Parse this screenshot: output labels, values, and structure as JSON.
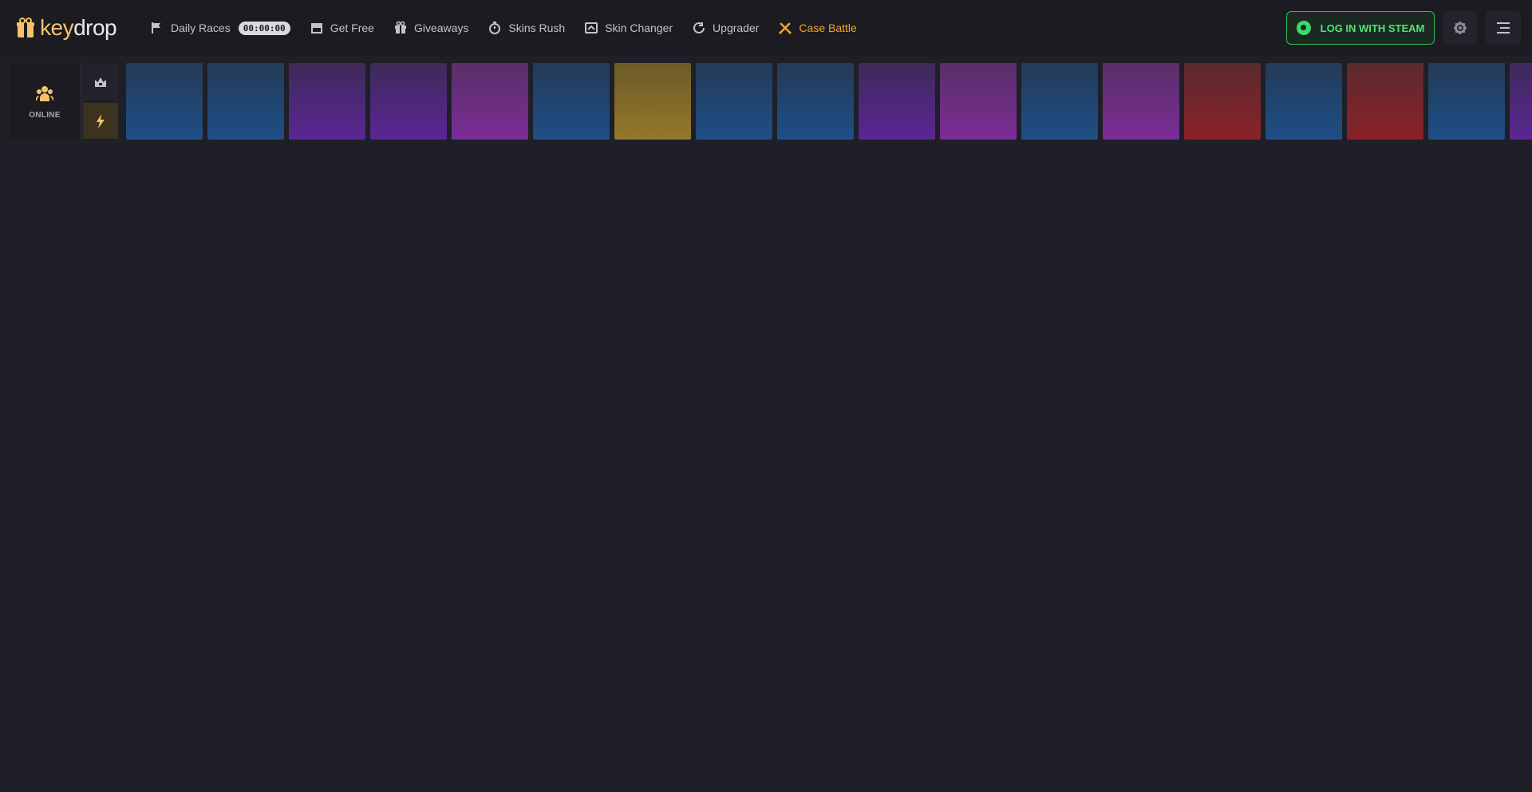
{
  "brand": {
    "logo_text_key": "key",
    "logo_text_drop": "drop"
  },
  "nav": {
    "items": [
      {
        "label": "Daily Races",
        "icon": "flag-icon"
      },
      {
        "label": "Get Free",
        "icon": "box-icon"
      },
      {
        "label": "Giveaways",
        "icon": "gift-icon"
      },
      {
        "label": "Skins Rush",
        "icon": "stopwatch-icon"
      },
      {
        "label": "Skin Changer",
        "icon": "swap-icon"
      },
      {
        "label": "Upgrader",
        "icon": "refresh-icon"
      },
      {
        "label": "Case Battle",
        "icon": "crossed-swords-icon"
      }
    ],
    "timer": "00:00:00"
  },
  "auth": {
    "login_label": "LOG IN WITH STEAM"
  },
  "sidebar": {
    "online_label": "ONLINE"
  },
  "colors": {
    "accent_orange": "#f5a623",
    "steam_green": "#4fe37a",
    "background": "#1f1f27"
  },
  "drops_strip": {
    "cards": [
      "blue",
      "blue",
      "purple",
      "purple",
      "pink",
      "blue",
      "gold",
      "blue",
      "blue",
      "purple",
      "pink",
      "blue",
      "pink",
      "red",
      "blue",
      "red",
      "blue",
      "purple"
    ]
  }
}
